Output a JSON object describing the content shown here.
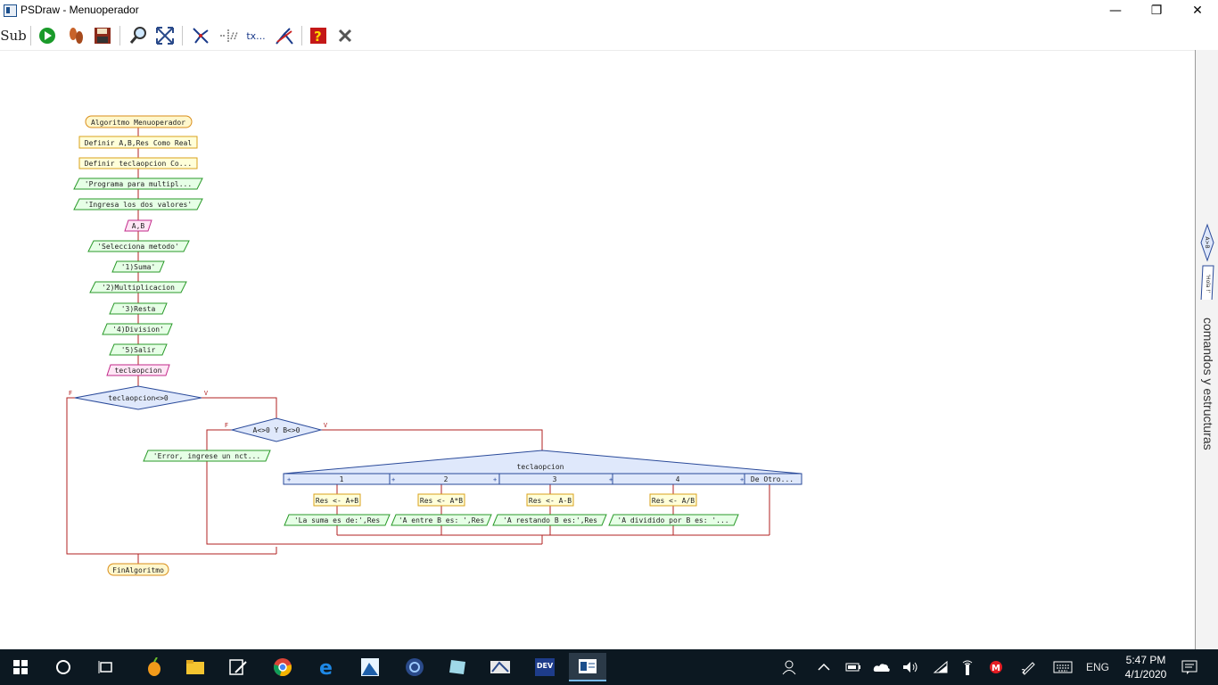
{
  "window": {
    "title": "PSDraw - Menuoperador"
  },
  "toolbar": {
    "sub_label": "Sub",
    "text_tool_label": "tx..."
  },
  "sidepanel": {
    "label": "comandos y estructuras",
    "mini_decision": "A>B",
    "mini_output": "'Hola !'"
  },
  "flowchart": {
    "start": "Algoritmo Menuoperador",
    "define1": "Definir A,B,Res Como Real",
    "define2": "Definir teclaopcion Co...",
    "out1": "'Programa para multipl...",
    "out2": "'Ingresa los dos valores'",
    "read1": "A,B",
    "out3": "'Selecciona metodo'",
    "out4": "'1)Suma'",
    "out5": "'2)Multiplicacion",
    "out6": "'3)Resta",
    "out7": "'4)Division'",
    "out8": "'5)Salir",
    "read2": "teclaopcion",
    "dec1": "teclaopcion<>0",
    "dec1_false": "F",
    "dec1_true": "V",
    "dec2": "A<>0 Y B<>0",
    "dec2_false": "F",
    "dec2_true": "V",
    "err": "'Error, ingrese un nct...",
    "switch_var": "teclaopcion",
    "cases": [
      "1",
      "2",
      "3",
      "4",
      "De Otro..."
    ],
    "assigns": [
      "Res <- A+B",
      "Res <- A*B",
      "Res <- A-B",
      "Res <- A/B"
    ],
    "outs": [
      "'La suma es de:',Res",
      "'A entre B es: ',Res",
      "'A restando B es:',Res",
      "'A dividido por B es: '..."
    ],
    "end": "FinAlgoritmo"
  },
  "taskbar": {
    "time": "5:47 PM",
    "date": "4/1/2020",
    "lang": "ENG",
    "dev_label": "DEV"
  },
  "colors": {
    "terminal_fill": "#fff7cc",
    "process_fill": "#ffffd9",
    "output_fill": "#e6ffe6",
    "input_fill": "#ffe6f5",
    "decision_fill": "#dfe8fb",
    "line": "#b22222"
  }
}
